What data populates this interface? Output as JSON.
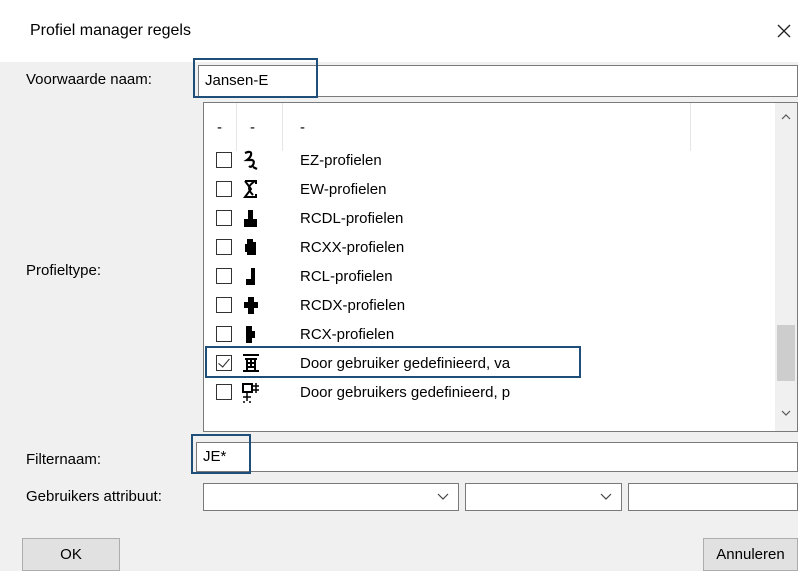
{
  "window": {
    "title": "Profiel manager regels",
    "close_glyph": "✕"
  },
  "form": {
    "condition_label": "Voorwaarde naam:",
    "condition_value": "Jansen-E",
    "profiletype_label": "Profieltype:",
    "filter_label": "Filternaam:",
    "filter_value": "JE*",
    "user_attr_label": "Gebruikers attribuut:"
  },
  "list": {
    "headers": [
      "-",
      "-",
      "-"
    ],
    "items": [
      {
        "label": "EZ-profielen",
        "icon": "ez-profile-icon",
        "checked": false
      },
      {
        "label": "EW-profielen",
        "icon": "ew-profile-icon",
        "checked": false
      },
      {
        "label": "RCDL-profielen",
        "icon": "rcdl-profile-icon",
        "checked": false
      },
      {
        "label": "RCXX-profielen",
        "icon": "rcxx-profile-icon",
        "checked": false
      },
      {
        "label": "RCL-profielen",
        "icon": "rcl-profile-icon",
        "checked": false
      },
      {
        "label": "RCDX-profielen",
        "icon": "rcdx-profile-icon",
        "checked": false
      },
      {
        "label": "RCX-profielen",
        "icon": "rcx-profile-icon",
        "checked": false
      },
      {
        "label": "Door gebruiker gedefinieerd, va",
        "icon": "user-defined-va-icon",
        "checked": true
      },
      {
        "label": "Door gebruikers gedefinieerd, p",
        "icon": "user-defined-p-icon",
        "checked": false
      }
    ]
  },
  "buttons": {
    "ok": "OK",
    "cancel": "Annuleren"
  },
  "colors": {
    "highlight": "#1f4e79",
    "dialog_bg": "#f0f0f0",
    "title_bg": "#ffffff"
  }
}
